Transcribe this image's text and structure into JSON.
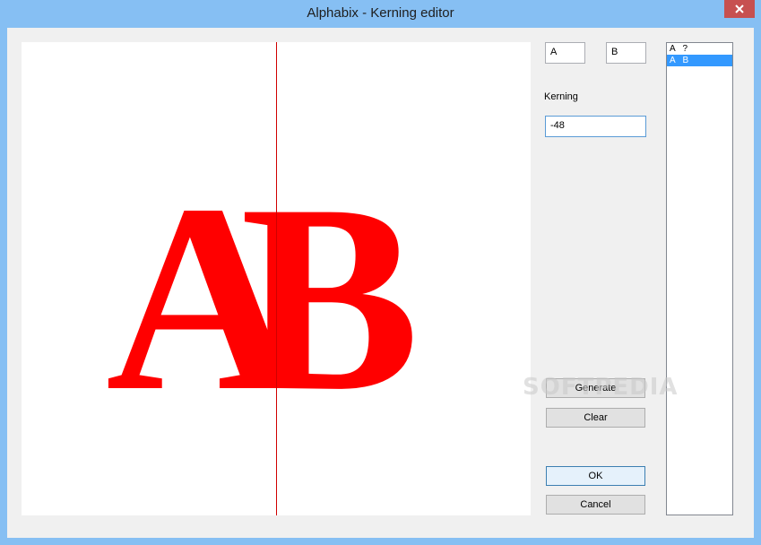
{
  "window": {
    "title": "Alphabix - Kerning editor",
    "close_icon": "close-icon"
  },
  "preview": {
    "left_glyph": "A",
    "right_glyph": "B",
    "glyph_color": "#ff0000",
    "guide_color": "#d00000"
  },
  "pair": {
    "first_char": "A",
    "second_char": "B"
  },
  "kerning": {
    "label": "Kerning",
    "value": "-48"
  },
  "buttons": {
    "generate": "Generate",
    "clear": "Clear",
    "ok": "OK",
    "cancel": "Cancel"
  },
  "pairs_list": {
    "items": [
      {
        "text": "A   ?",
        "selected": false
      },
      {
        "text": "A   B",
        "selected": true
      }
    ]
  },
  "watermark": "SOFTPEDIA"
}
